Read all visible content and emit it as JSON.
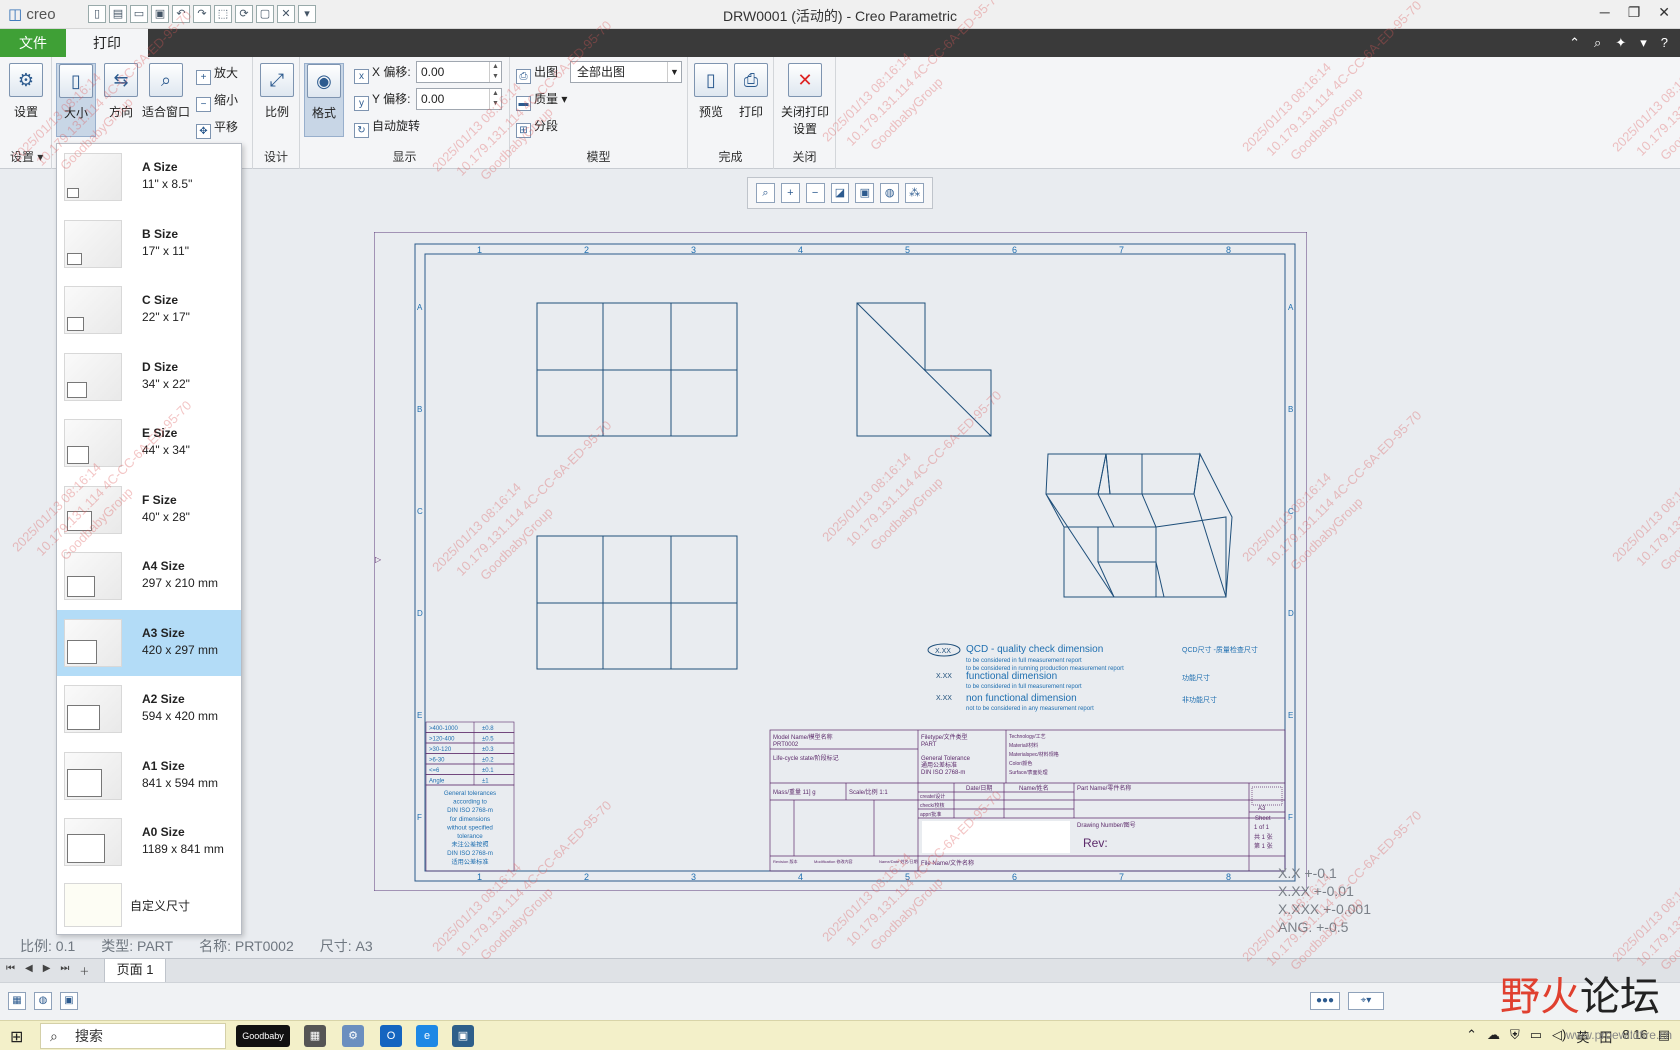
{
  "app": {
    "logo": "creo",
    "window_title": "DRW0001 (活动的) - Creo Parametric"
  },
  "tabs": {
    "file": "文件",
    "print": "打印"
  },
  "ribbon": {
    "setup": {
      "label": "设置",
      "group": "设置"
    },
    "size": "大小",
    "orientation": "方向",
    "fit": "适合窗口",
    "zoom_in": "放大",
    "zoom_out": "缩小",
    "pan": "平移",
    "scale": {
      "label": "比例",
      "group": "设计"
    },
    "format": "格式",
    "x_offset": {
      "label": "X 偏移:",
      "value": "0.00"
    },
    "y_offset": {
      "label": "Y 偏移:",
      "value": "0.00"
    },
    "auto_rotate": "自动旋转",
    "display_group": "显示",
    "output": "出图",
    "output_value": "全部出图",
    "quality": "质量",
    "segment": "分段",
    "model_group": "模型",
    "preview": "预览",
    "print": "打印",
    "finish_group": "完成",
    "close_print": "关闭打印设置",
    "close_group": "关闭"
  },
  "size_options": [
    {
      "name": "A Size",
      "dims": "11\" x 8.5\"",
      "selected": false
    },
    {
      "name": "B Size",
      "dims": "17\" x 11\"",
      "selected": false
    },
    {
      "name": "C Size",
      "dims": "22\" x 17\"",
      "selected": false
    },
    {
      "name": "D Size",
      "dims": "34\" x 22\"",
      "selected": false
    },
    {
      "name": "E Size",
      "dims": "44\" x 34\"",
      "selected": false
    },
    {
      "name": "F Size",
      "dims": "40\" x 28\"",
      "selected": false
    },
    {
      "name": "A4 Size",
      "dims": "297 x 210 mm",
      "selected": false
    },
    {
      "name": "A3 Size",
      "dims": "420 x 297 mm",
      "selected": true
    },
    {
      "name": "A2 Size",
      "dims": "594 x 420 mm",
      "selected": false
    },
    {
      "name": "A1 Size",
      "dims": "841 x 594 mm",
      "selected": false
    },
    {
      "name": "A0 Size",
      "dims": "1189 x 841 mm",
      "selected": false
    }
  ],
  "custom_size": "自定义尺寸",
  "drawing": {
    "columns": [
      "1",
      "2",
      "3",
      "4",
      "5",
      "6",
      "7",
      "8"
    ],
    "rows": [
      "A",
      "B",
      "C",
      "D",
      "E",
      "F"
    ],
    "legend": {
      "qcd_title": "QCD - quality check dimension",
      "qcd_sub1": "to be considered in full measurement report",
      "qcd_sub2": "to be considered in running production measurement report",
      "qcd_cn": "QCD尺寸 -质量检查尺寸",
      "func_title": "functional dimension",
      "func_sub": "to be considered in full measurement report",
      "func_cn": "功能尺寸",
      "nonfunc_title": "non functional dimension",
      "nonfunc_sub": "not to be considered in any measurement report",
      "nonfunc_cn": "非功能尺寸",
      "sym": "X.XX"
    },
    "tolerance_table": [
      [
        ">400-1000",
        "±0.8"
      ],
      [
        ">120-400",
        "±0.5"
      ],
      [
        ">30-120",
        "±0.3"
      ],
      [
        ">6-30",
        "±0.2"
      ],
      [
        "<=6",
        "±0.1"
      ],
      [
        "Angle",
        "±1"
      ]
    ],
    "general_tol_note": [
      "General tolerances",
      "according to",
      "DIN ISO 2768-m",
      "for dimensions",
      "without specified",
      "tolerance",
      "未注公差按照",
      "DIN ISO 2768-m",
      "适用公差标准"
    ],
    "title_block": {
      "model_name": "Model Name/模型名称",
      "model_value": "PRT0002",
      "life_cycle": "Life-cycle state/阶段标记",
      "filetype": "Filetype/文件类型",
      "filetype_value": "PART",
      "general_tol": "General Tolerance",
      "general_tol_cn": "通用公差标准",
      "din": "DIN ISO 2768-m",
      "technology": "Technology/工艺",
      "material": "Material/材料",
      "material_spec": "Materialspec/材料规格",
      "color": "Color/颜色",
      "surface": "Surface/表面处理",
      "mass": "Mass/重量 11] g",
      "scale": "Scale/比例 1:1",
      "date": "Date/日期",
      "name": "Name/姓名",
      "part_name": "Part Name/零件名称",
      "created": "create/设计",
      "check": "check/校核",
      "appr": "appr/批准",
      "drawing_number": "Drawing Number/图号",
      "rev": "Rev:",
      "size": "A3",
      "sheet": "Sheet",
      "sheet_of": "1 of 1",
      "total": "共 1 张",
      "page": "第 1 张",
      "revision": "Revision 版本",
      "modification": "Modification 修改内容",
      "name_date": "Name/Date 姓名/日期",
      "file_name": "File Name/文件名称"
    }
  },
  "status": {
    "scale": "比例: 0.1",
    "type": "类型: PART",
    "name": "名称: PRT0002",
    "size": "尺寸: A3"
  },
  "tolerances": [
    "X.X   +-0.1",
    "X.XX   +-0.01",
    "X.XXX  +-0.001",
    "ANG. +-0.5"
  ],
  "page_tab": "页面 1",
  "taskbar": {
    "search": "搜索",
    "app1": "Goodbaby",
    "ime": "英",
    "time": "8:16"
  },
  "forum": {
    "logo_a": "野火",
    "logo_b": "论坛",
    "url": "www.proewildfire.cn"
  },
  "watermark": [
    "2025/01/13 08:16:14",
    "10.179.131.114 4C-CC-6A-ED-95-70",
    "GoodbabyGroup"
  ]
}
